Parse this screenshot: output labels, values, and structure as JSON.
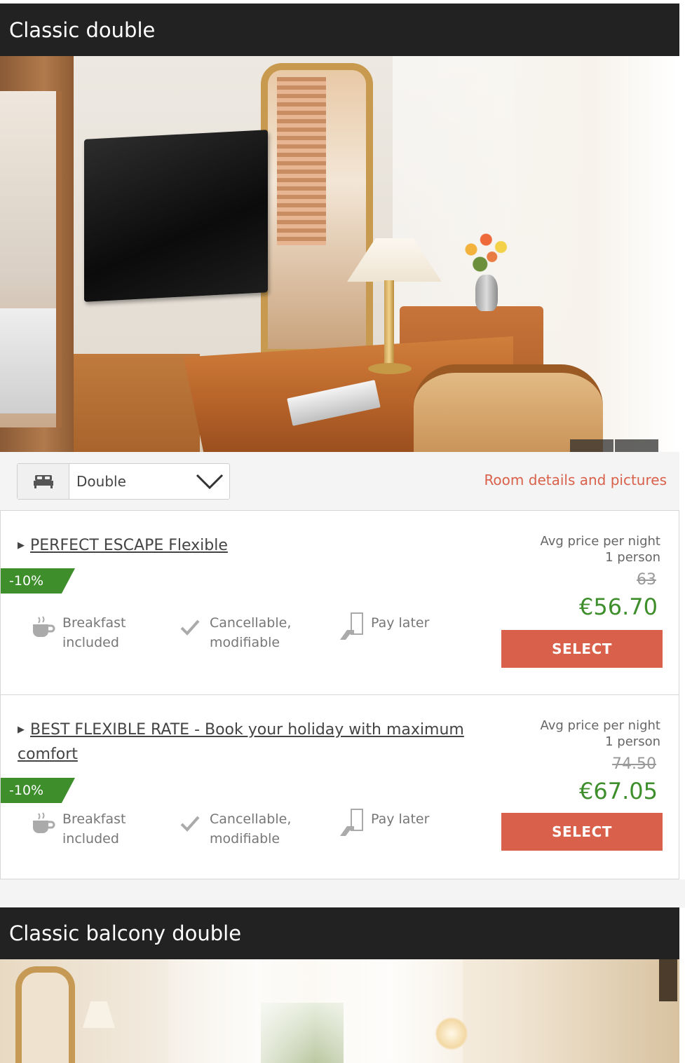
{
  "rooms": [
    {
      "title": "Classic double",
      "bed_type": "Double",
      "details_link": "Room details and pictures",
      "rates": [
        {
          "name": "PERFECT ESCAPE Flexible",
          "discount": "-10%",
          "features": [
            {
              "label": "Breakfast\nincluded",
              "icon": "coffee-cup-icon"
            },
            {
              "label": "Cancellable,\nmodifiable",
              "icon": "checkmark-icon"
            },
            {
              "label": "Pay later",
              "icon": "pay-later-icon"
            }
          ],
          "avg_label": "Avg price per night",
          "persons": "1 person",
          "old_price": "63",
          "price": "€56.70",
          "button": "SELECT"
        },
        {
          "name": "BEST FLEXIBLE RATE - Book your holiday with maximum comfort",
          "discount": "-10%",
          "features": [
            {
              "label": "Breakfast\nincluded",
              "icon": "coffee-cup-icon"
            },
            {
              "label": "Cancellable,\nmodifiable",
              "icon": "checkmark-icon"
            },
            {
              "label": "Pay later",
              "icon": "pay-later-icon"
            }
          ],
          "avg_label": "Avg price per night",
          "persons": "1 person",
          "old_price": "74.50",
          "price": "€67.05",
          "button": "SELECT"
        }
      ]
    },
    {
      "title": "Classic balcony double"
    }
  ],
  "carousel": {
    "prev_icon": "‹",
    "next_icon": "›",
    "slides": 2,
    "active_slide": 1
  },
  "colors": {
    "header_bg": "#222222",
    "accent": "#d9604a",
    "price_green": "#3e8e2c"
  }
}
